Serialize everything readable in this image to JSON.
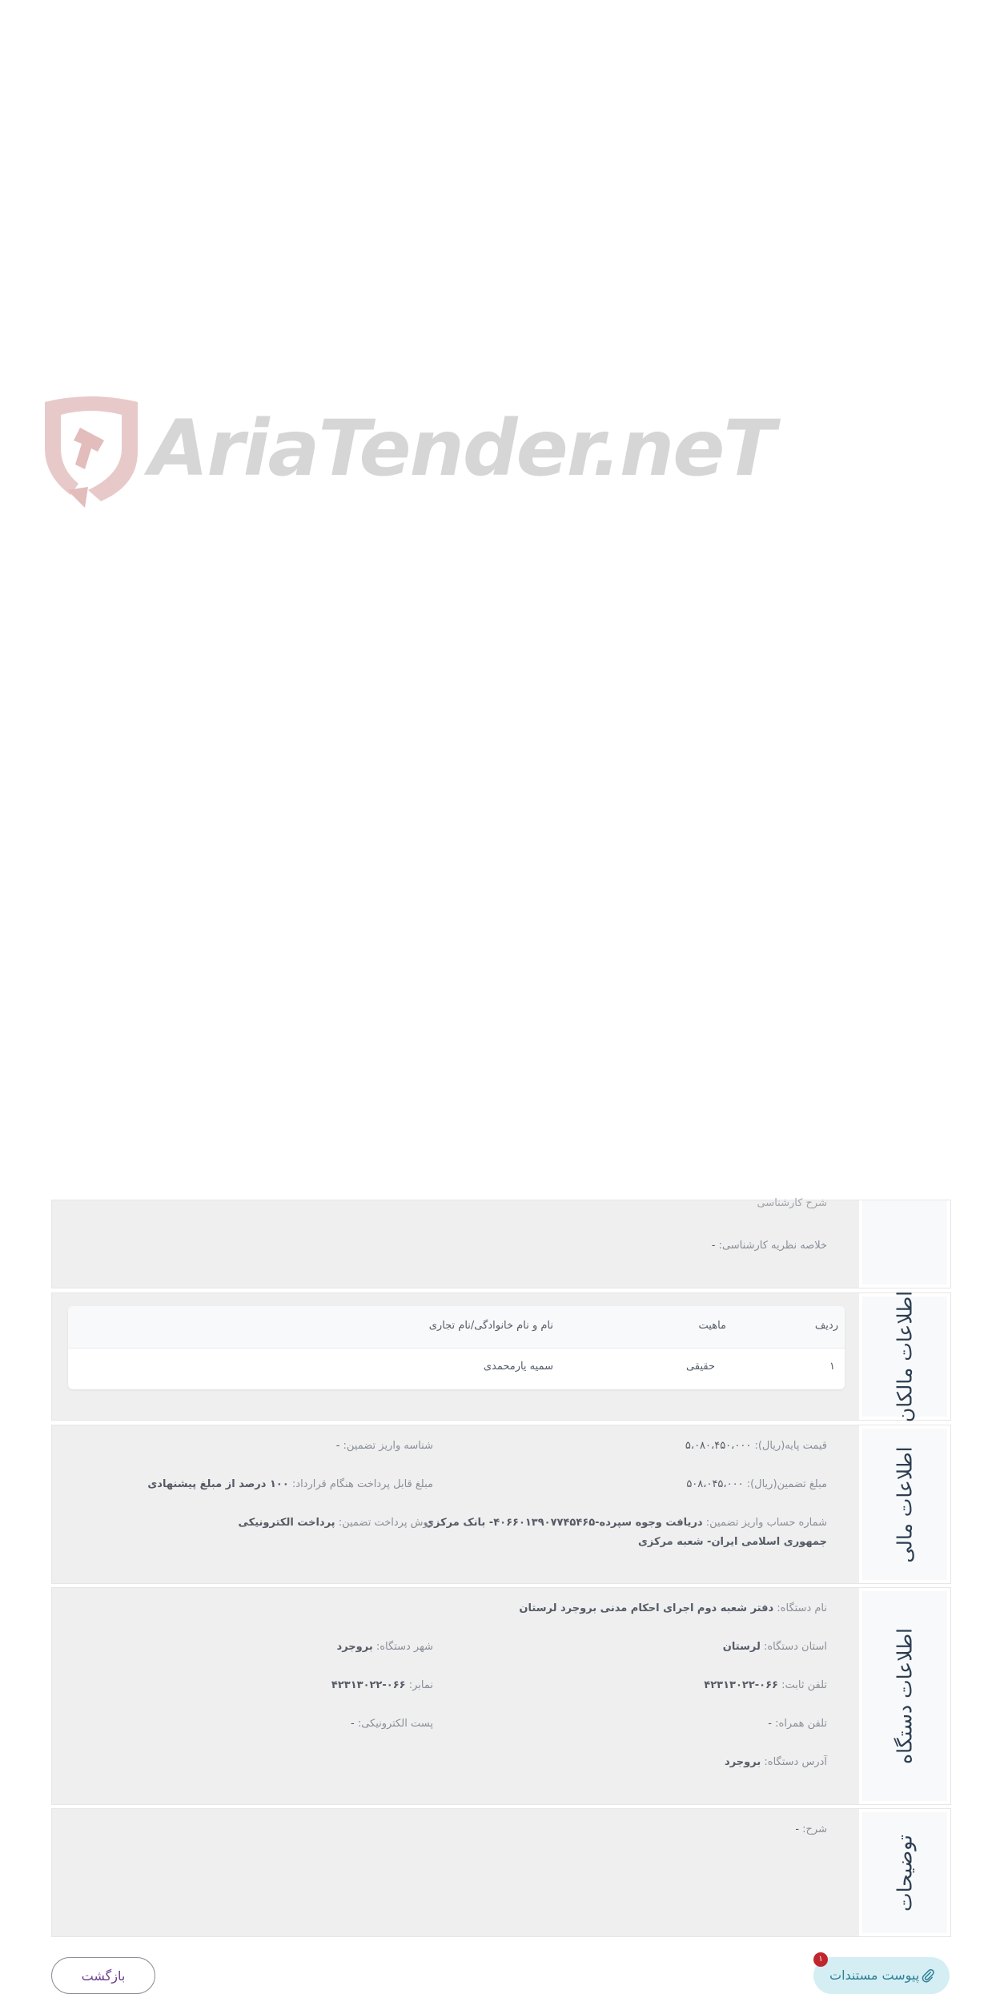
{
  "logo": {
    "text": "AriaTender.neT"
  },
  "sections": {
    "expert": {
      "partial_label": "شرح کارشناسی",
      "summary_label": "خلاصه نظریه کارشناسی:",
      "summary_value": "-"
    },
    "owners": {
      "title": "اطلاعات مالکان",
      "columns": [
        "ردیف",
        "ماهیت",
        "نام و نام خانوادگی/نام تجاری"
      ],
      "rows": [
        [
          "۱",
          "حقیقی",
          "سمیه یارمحمدی"
        ]
      ]
    },
    "financial": {
      "title": "اطلاعات مالی",
      "base_price_label": "قیمت پایه(ریال):",
      "base_price_value": "۵،۰۸۰،۴۵۰،۰۰۰",
      "guarantee_id_label": "شناسه واریز تضمین:",
      "guarantee_id_value": "-",
      "guarantee_amount_label": "مبلغ تضمین(ریال):",
      "guarantee_amount_value": "۵۰۸،۰۴۵،۰۰۰",
      "payable_label": "مبلغ قابل پرداخت هنگام قرارداد:",
      "payable_value": "۱۰۰ درصد از مبلغ پیشنهادی",
      "account_label": "شماره حساب واریز تضمین:",
      "account_value_line1": "دریافت وجوه سپرده-۴۰۶۶۰۱۳۹۰۷۷۴۵۴۶۵- بانک مرکزی",
      "account_value_line2": "جمهوری اسلامی ایران- شعبه مرکزی",
      "payment_method_label": "روش پرداخت تضمین:",
      "payment_method_value": "پرداخت الکترونیکی"
    },
    "agency": {
      "title": "اطلاعات دستگاه",
      "name_label": "نام دستگاه:",
      "name_value": "دفتر شعبه دوم اجرای احکام مدنی بروجرد لرستان",
      "province_label": "استان دستگاه:",
      "province_value": "لرستان",
      "city_label": "شهر دستگاه:",
      "city_value": "بروجرد",
      "phone_label": "تلفن ثابت:",
      "phone_value": "۰۶۶-۴۲۳۱۳۰۲۲",
      "fax_label": "نمابر:",
      "fax_value": "۰۶۶-۴۲۳۱۳۰۲۲",
      "mobile_label": "تلفن همراه:",
      "mobile_value": "-",
      "email_label": "پست الکترونیکی:",
      "email_value": "-",
      "address_label": "آدرس دستگاه:",
      "address_value": "بروجرد"
    },
    "notes": {
      "title": "توضیحات",
      "desc_label": "شرح:",
      "desc_value": "-"
    }
  },
  "footer": {
    "attachments_label": "پیوست مستندات",
    "attachments_count": "۱",
    "back_label": "بازگشت"
  }
}
